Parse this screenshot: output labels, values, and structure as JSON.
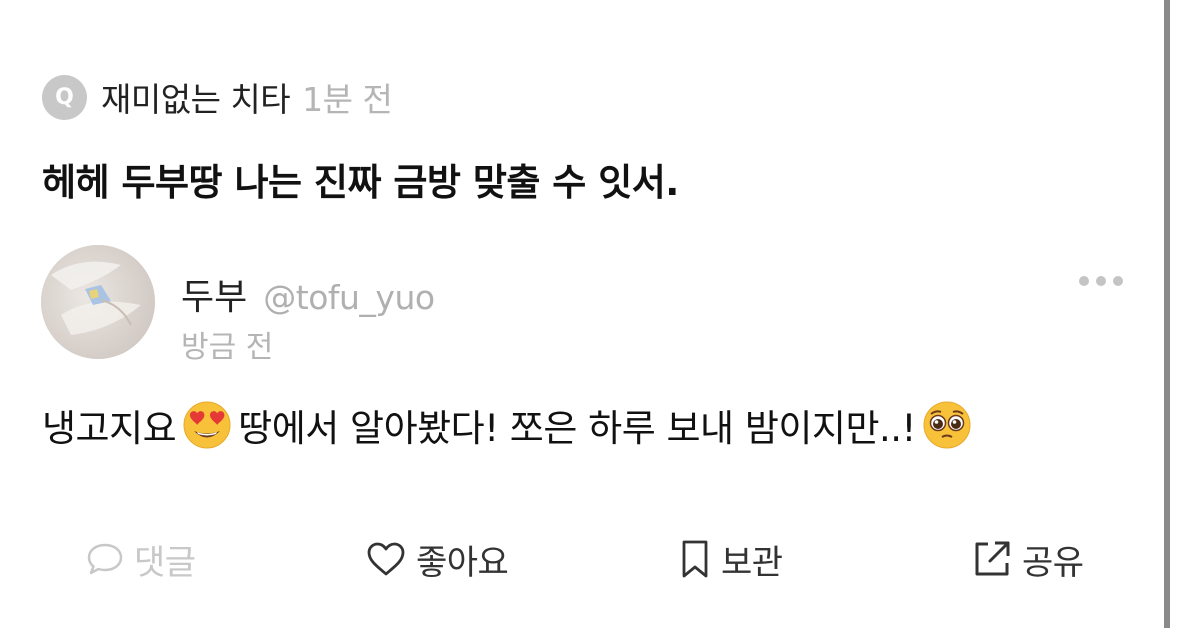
{
  "question": {
    "badge": "Q",
    "author": "재미없는 치타",
    "time": "1분 전",
    "text": "헤헤 두부땅 나는 진짜 금방 맞출 수 잇서."
  },
  "answer": {
    "name": "두부",
    "handle": "@tofu_yuo",
    "time": "방금 전",
    "text_part1": "냉고지요",
    "text_part2": "땅에서 알아봤다! 쪼은 하루 보내 밤이지만..!",
    "emoji_1": "smiling-face-with-heart-eyes",
    "emoji_2": "pleading-face"
  },
  "actions": {
    "comment": "댓글",
    "like": "좋아요",
    "save": "보관",
    "share": "공유"
  },
  "colors": {
    "badge_bg": "#c8c8c8",
    "muted_text": "#b5b5b5",
    "disabled_action": "#c8c8c8",
    "action_text": "#333333"
  }
}
